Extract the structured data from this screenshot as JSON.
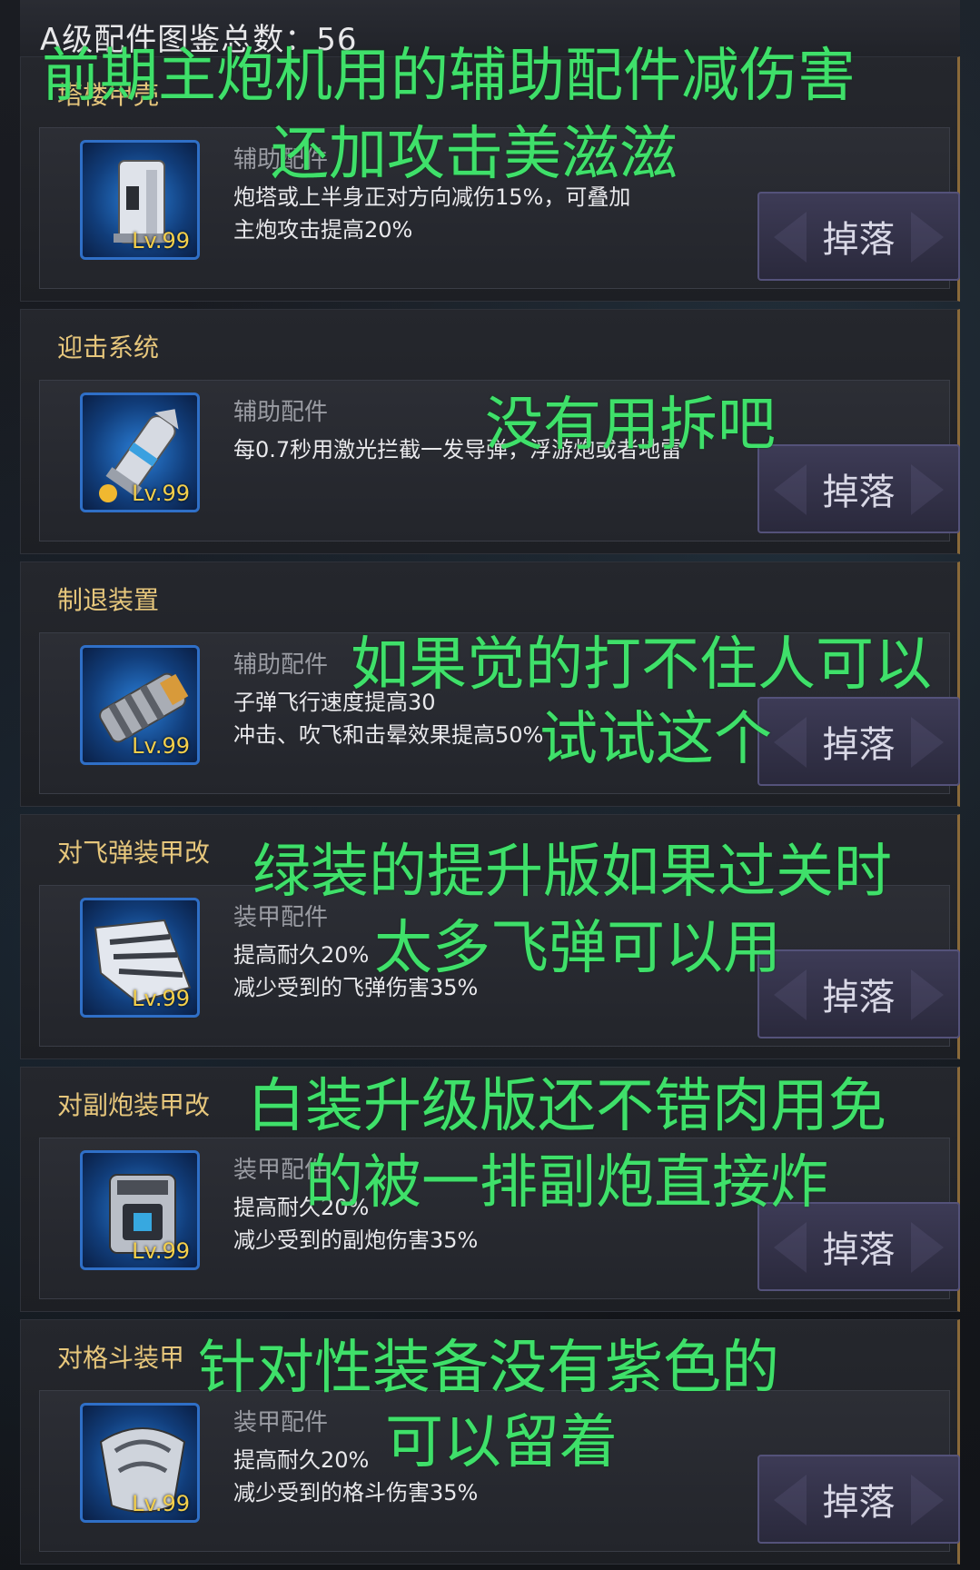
{
  "header": {
    "title": "A级配件图鉴总数：56"
  },
  "cards": [
    {
      "name": "塔楼甲壳",
      "type": "辅助配件",
      "level": "Lv.99",
      "desc": [
        "炮塔或上半身正对方向减伤15%，可叠加",
        "主炮攻击提高20%"
      ],
      "drop": "掉落",
      "icon": "turret-armor-icon"
    },
    {
      "name": "迎击系统",
      "type": "辅助配件",
      "level": "Lv.99",
      "desc": [
        "每0.7秒用激光拦截一发导弹，浮游炮或者地雷",
        ""
      ],
      "drop": "掉落",
      "icon": "interceptor-icon"
    },
    {
      "name": "制退装置",
      "type": "辅助配件",
      "level": "Lv.99",
      "desc": [
        "子弹飞行速度提高30",
        "冲击、吹飞和击晕效果提高50%"
      ],
      "drop": "掉落",
      "icon": "recoil-device-icon"
    },
    {
      "name": "对飞弹装甲改",
      "type": "装甲配件",
      "level": "Lv.99",
      "desc": [
        "提高耐久20%",
        "减少受到的飞弹伤害35%"
      ],
      "drop": "掉落",
      "icon": "missile-armor-icon"
    },
    {
      "name": "对副炮装甲改",
      "type": "装甲配件",
      "level": "Lv.99",
      "desc": [
        "提高耐久20%",
        "减少受到的副炮伤害35%"
      ],
      "drop": "掉落",
      "icon": "subcannon-armor-icon"
    },
    {
      "name": "对格斗装甲",
      "type": "装甲配件",
      "level": "Lv.99",
      "desc": [
        "提高耐久20%",
        "减少受到的格斗伤害35%"
      ],
      "drop": "掉落",
      "icon": "melee-armor-icon"
    }
  ],
  "overlays": [
    "前期主炮机用的辅助配件减伤害",
    "还加攻击美滋滋",
    "没有用拆吧",
    "如果觉的打不住人可以",
    "试试这个",
    "绿装的提升版如果过关时",
    "太多飞弹可以用",
    "白装升级版还不错肉用免",
    "的被一排副炮直接炸",
    "针对性装备没有紫色的",
    "可以留着"
  ],
  "colors": {
    "overlay_text": "#3fe06a",
    "card_name": "#e7c77c",
    "level": "#f3cf4b",
    "icon_frame": "#2f6fc7"
  }
}
